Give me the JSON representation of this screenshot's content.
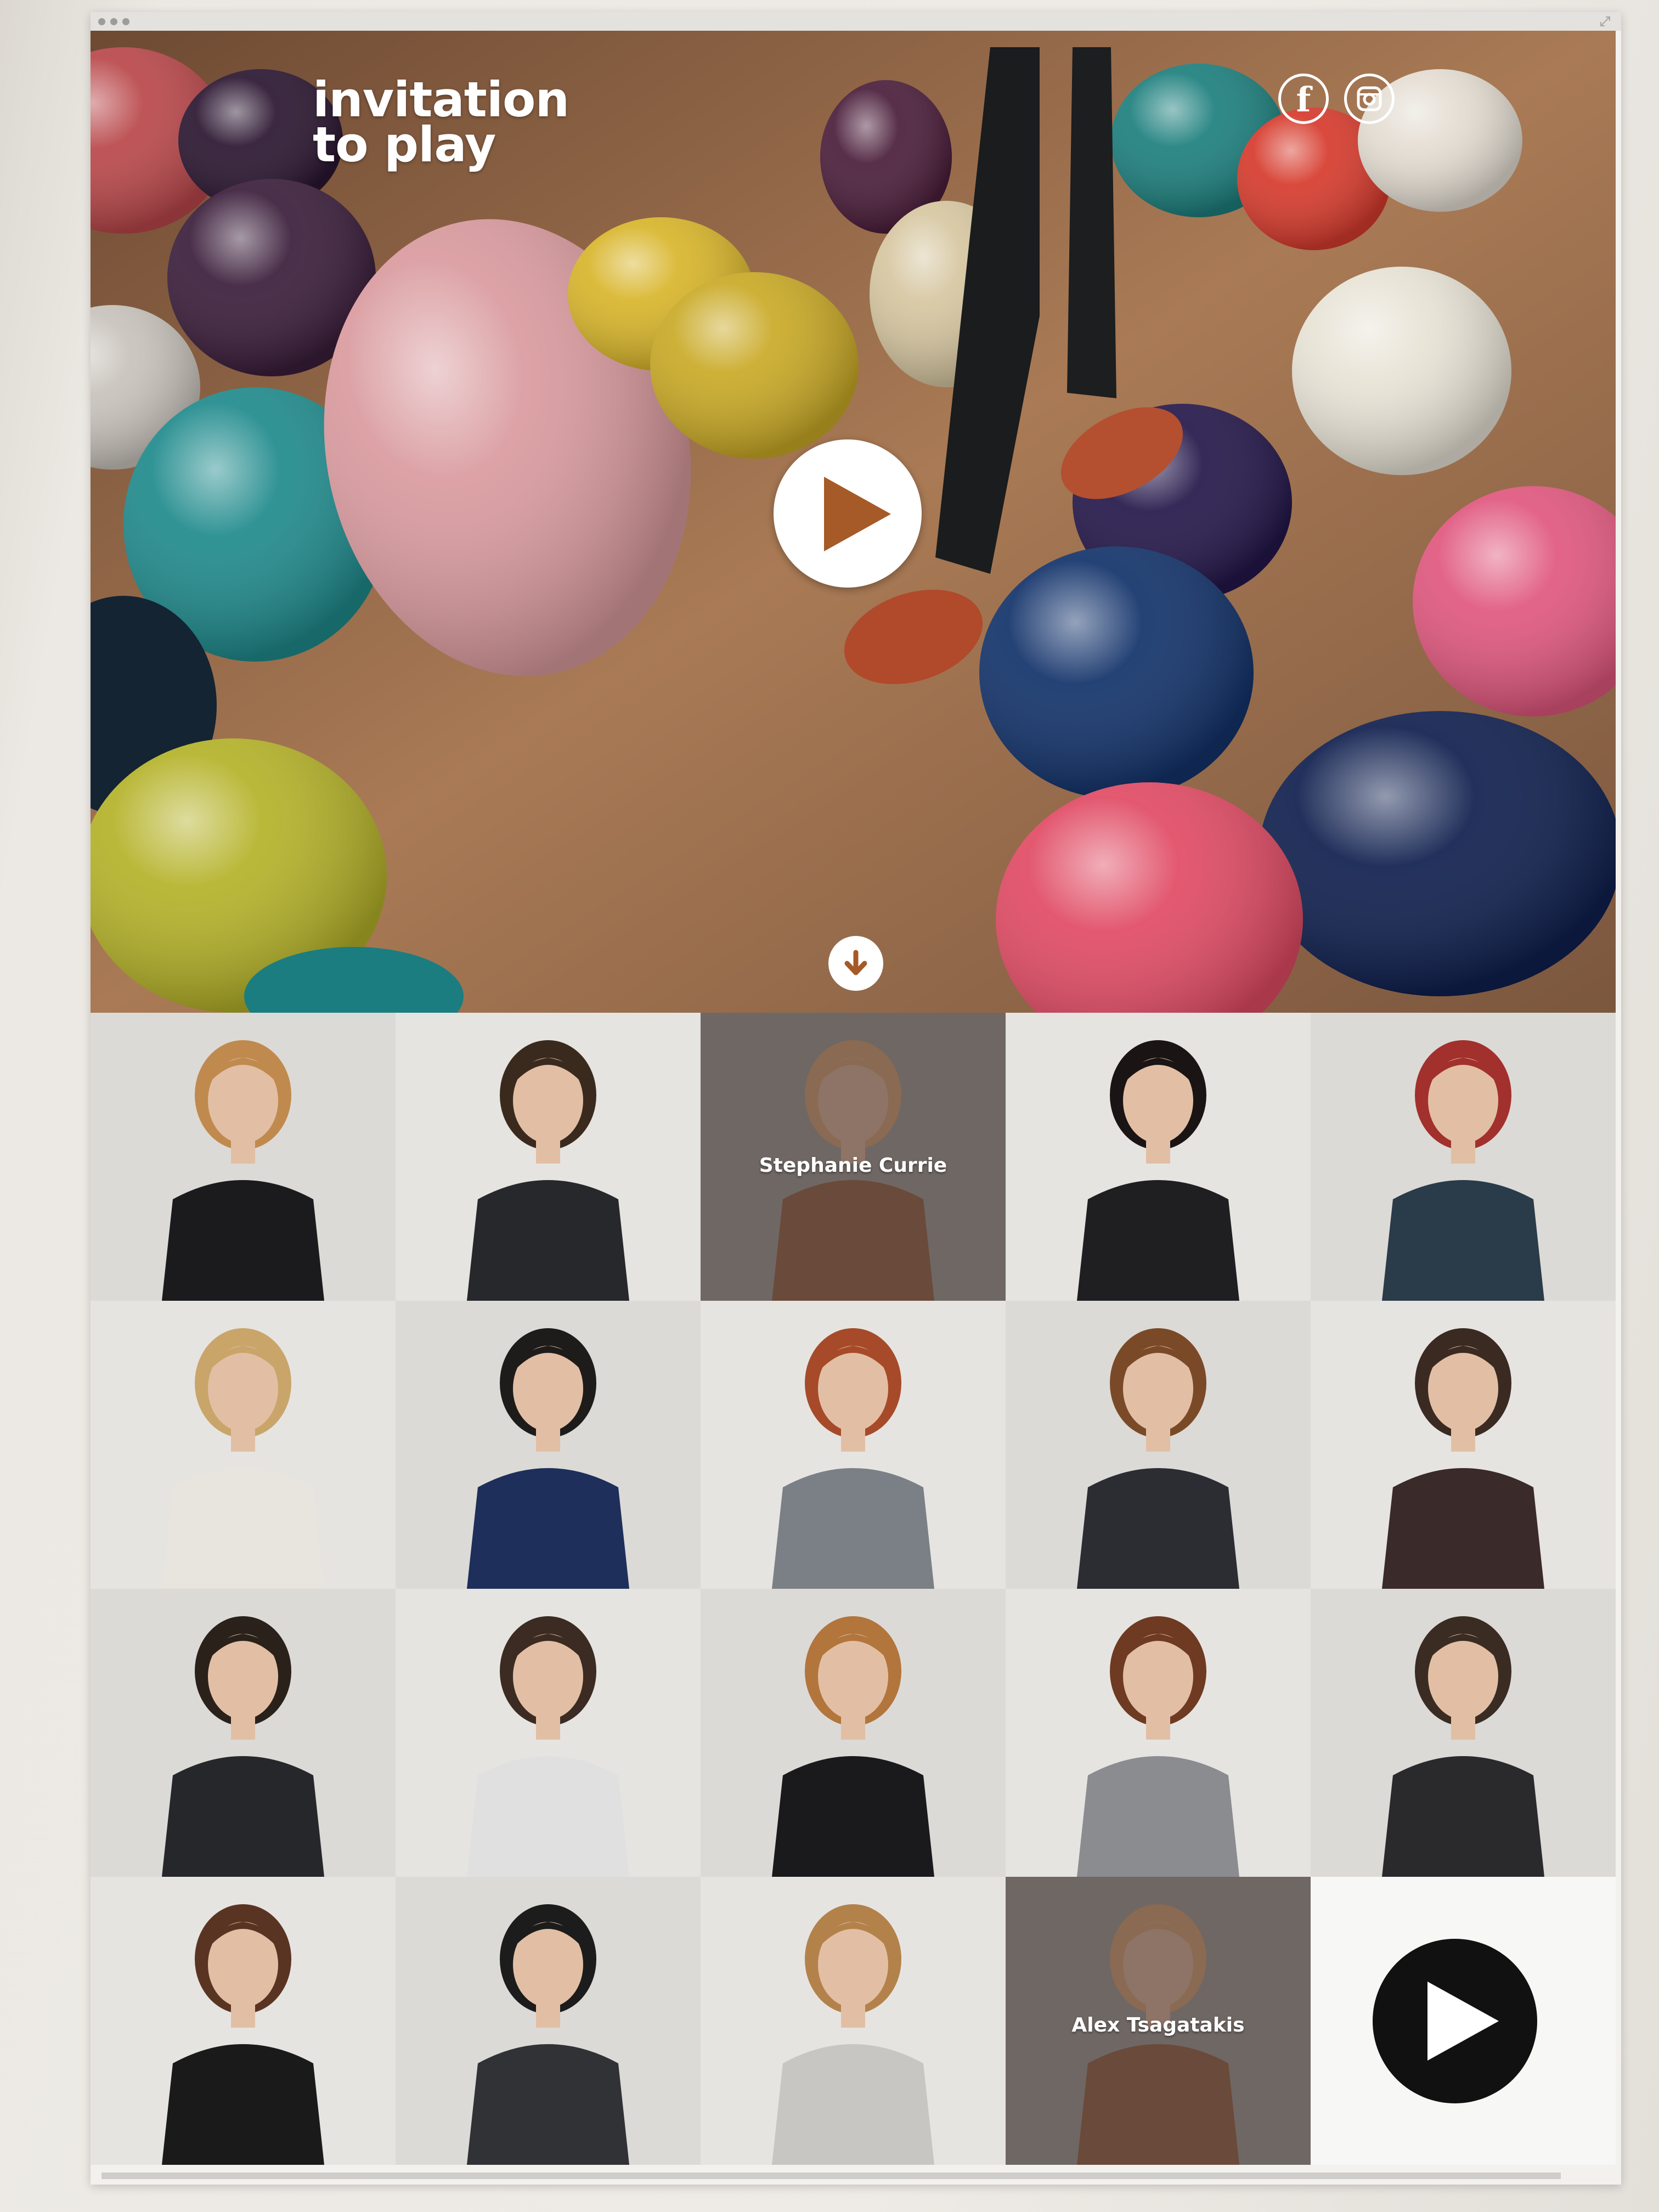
{
  "hero": {
    "title_line1": "invitation",
    "title_line2": "to play",
    "social": [
      {
        "name": "facebook-icon",
        "glyph": "f"
      },
      {
        "name": "instagram-icon",
        "glyph": "camera"
      }
    ],
    "play_button": "play-video",
    "scroll_button": "scroll-down"
  },
  "colors": {
    "accent_play": "#a65a28",
    "tile_highlight_overlay": "#6b6461",
    "big_play": "#111111"
  },
  "grid": {
    "rows": 4,
    "columns": 5,
    "tiles": [
      {
        "id": 1,
        "label": "",
        "highlight": false
      },
      {
        "id": 2,
        "label": "",
        "highlight": false
      },
      {
        "id": 3,
        "label": "Stephanie Currie",
        "highlight": true
      },
      {
        "id": 4,
        "label": "",
        "highlight": false
      },
      {
        "id": 5,
        "label": "",
        "highlight": false
      },
      {
        "id": 6,
        "label": "",
        "highlight": false
      },
      {
        "id": 7,
        "label": "",
        "highlight": false
      },
      {
        "id": 8,
        "label": "",
        "highlight": false
      },
      {
        "id": 9,
        "label": "",
        "highlight": false
      },
      {
        "id": 10,
        "label": "",
        "highlight": false
      },
      {
        "id": 11,
        "label": "",
        "highlight": false
      },
      {
        "id": 12,
        "label": "",
        "highlight": false
      },
      {
        "id": 13,
        "label": "",
        "highlight": false
      },
      {
        "id": 14,
        "label": "",
        "highlight": false
      },
      {
        "id": 15,
        "label": "",
        "highlight": false
      },
      {
        "id": 16,
        "label": "",
        "highlight": false
      },
      {
        "id": 17,
        "label": "",
        "highlight": false
      },
      {
        "id": 18,
        "label": "",
        "highlight": false
      },
      {
        "id": 19,
        "label": "Alex Tsagatakis",
        "highlight": true
      },
      {
        "id": 20,
        "label": "",
        "highlight": false,
        "play_tile": true
      }
    ]
  }
}
